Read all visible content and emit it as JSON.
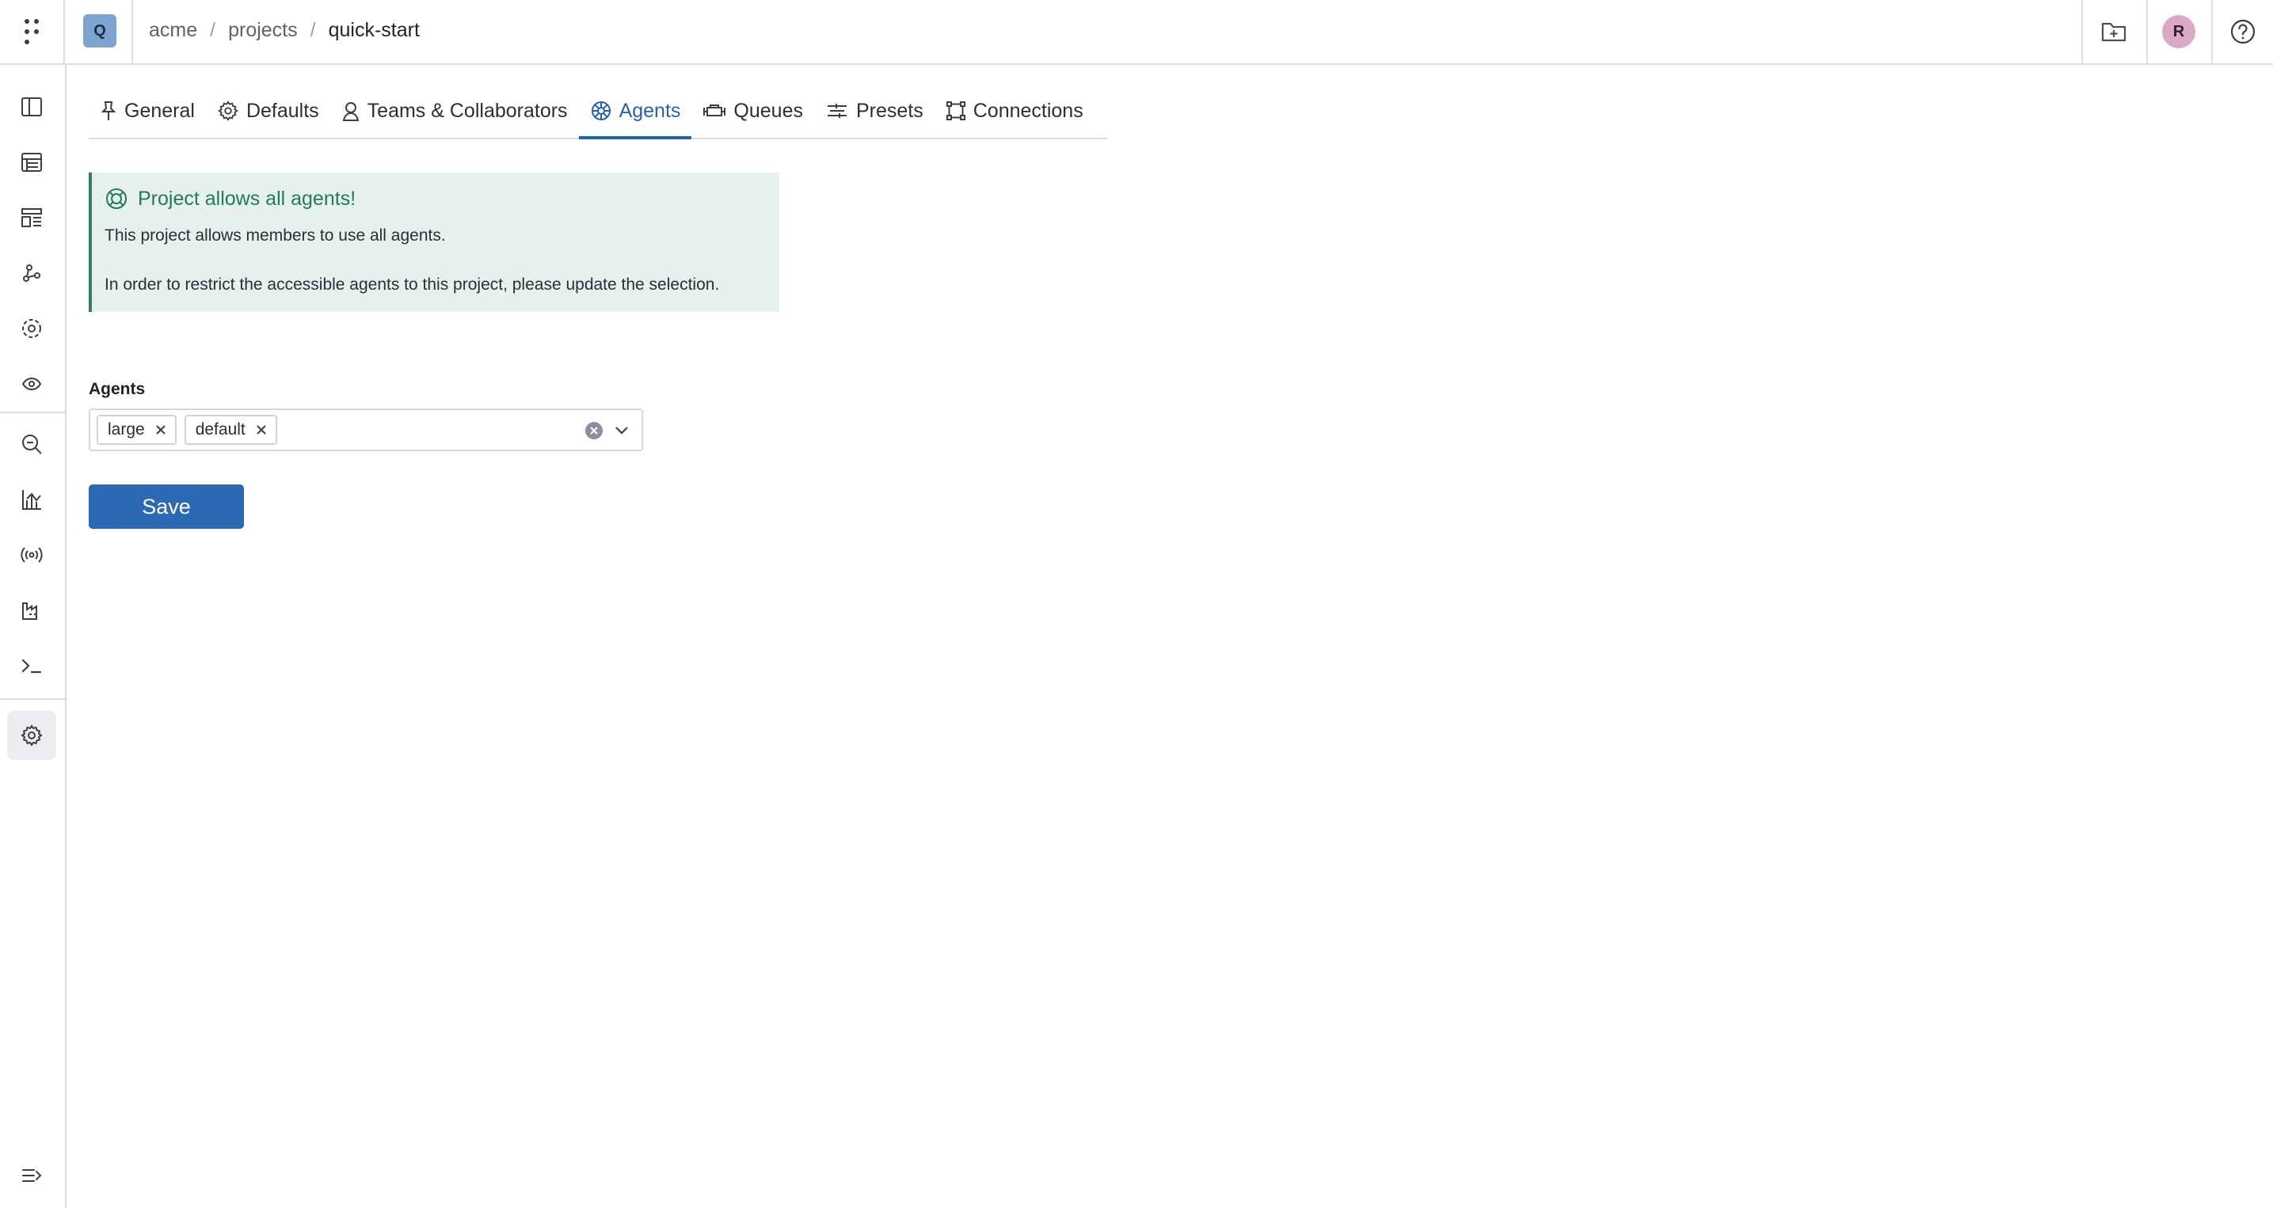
{
  "topbar": {
    "project_initial": "Q",
    "breadcrumb": [
      "acme",
      "projects",
      "quick-start"
    ],
    "breadcrumb_separator": "/",
    "user_initial": "R",
    "icons": [
      "apps-grid-icon",
      "new-folder-icon",
      "help-icon"
    ]
  },
  "sidebar": {
    "items": [
      {
        "name": "panels",
        "icon": "sidebar-panel-icon"
      },
      {
        "name": "table",
        "icon": "table-icon"
      },
      {
        "name": "dashboards",
        "icon": "dashboard-icon"
      },
      {
        "name": "graph",
        "icon": "graph-nodes-icon"
      },
      {
        "name": "agents",
        "icon": "agents-icon"
      },
      {
        "name": "runs",
        "icon": "eye-cycle-icon"
      },
      {
        "name": "search",
        "icon": "search-icon"
      },
      {
        "name": "analytics",
        "icon": "chart-icon"
      },
      {
        "name": "streams",
        "icon": "broadcast-icon"
      },
      {
        "name": "registry",
        "icon": "factory-icon"
      },
      {
        "name": "terminal",
        "icon": "terminal-icon"
      },
      {
        "name": "settings",
        "icon": "gear-icon",
        "active": true
      },
      {
        "name": "collapse",
        "icon": "collapse-sidebar-icon"
      }
    ]
  },
  "tabs": [
    {
      "label": "General",
      "icon": "pin-icon",
      "active": false
    },
    {
      "label": "Defaults",
      "icon": "gear-icon",
      "active": false
    },
    {
      "label": "Teams & Collaborators",
      "icon": "user-icon",
      "active": false
    },
    {
      "label": "Agents",
      "icon": "agents-wheel-icon",
      "active": true
    },
    {
      "label": "Queues",
      "icon": "queue-icon",
      "active": false
    },
    {
      "label": "Presets",
      "icon": "presets-icon",
      "active": false
    },
    {
      "label": "Connections",
      "icon": "connections-icon",
      "active": false
    }
  ],
  "callout": {
    "title": "Project allows all agents!",
    "line1": "This project allows members to use all agents.",
    "line2": "In order to restrict the accessible agents to this project, please update the selection."
  },
  "agents_field": {
    "label": "Agents",
    "selected": [
      "large",
      "default"
    ]
  },
  "save_label": "Save",
  "colors": {
    "accent": "#2563a8",
    "button": "#2a69b3",
    "callout_bg": "#e6f1ee",
    "callout_accent": "#2f7d63"
  }
}
